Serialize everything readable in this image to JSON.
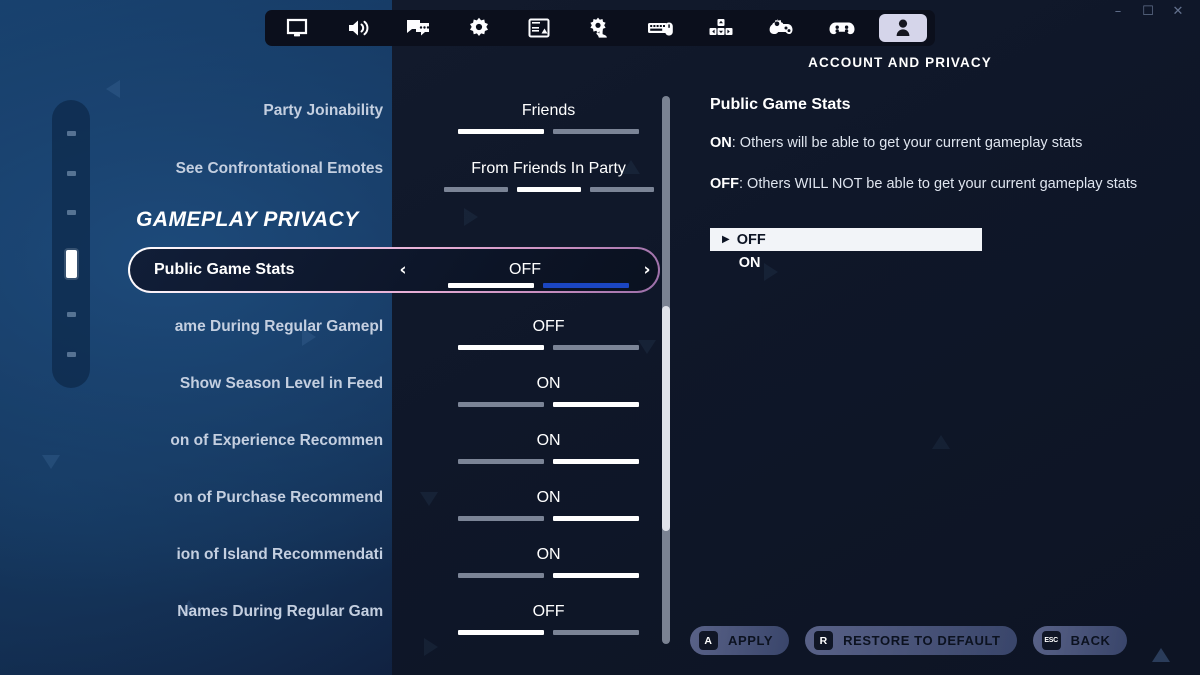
{
  "window": {
    "minimize": "–",
    "maximize": "☐",
    "close": "✕"
  },
  "tabs": [
    {
      "name": "video",
      "icon": "monitor-icon"
    },
    {
      "name": "audio",
      "icon": "speaker-icon"
    },
    {
      "name": "chat",
      "icon": "chat-bubbles-icon"
    },
    {
      "name": "game",
      "icon": "gear-icon"
    },
    {
      "name": "hud",
      "icon": "hud-layout-icon"
    },
    {
      "name": "brightness",
      "icon": "touch-gear-icon"
    },
    {
      "name": "keyboard",
      "icon": "keyboard-mouse-icon"
    },
    {
      "name": "wireless",
      "icon": "dpad-keys-icon"
    },
    {
      "name": "controller",
      "icon": "controller-gear-icon"
    },
    {
      "name": "gamepad",
      "icon": "gamepad-icon"
    },
    {
      "name": "account",
      "icon": "person-icon",
      "active": true
    }
  ],
  "header": {
    "title": "ACCOUNT AND PRIVACY"
  },
  "pager": {
    "total": 6,
    "active_index": 3
  },
  "section": {
    "title": "GAMEPLAY PRIVACY"
  },
  "settings": [
    {
      "label": "Party Joinability",
      "value": "Friends",
      "ticks": 2,
      "selected_tick": 0
    },
    {
      "label": "See Confrontational Emotes",
      "value": "From Friends In Party",
      "ticks": 3,
      "selected_tick": 1
    },
    {
      "label": "Public Game Stats",
      "value": "OFF",
      "ticks": 2,
      "selected_tick": 0,
      "highlighted": true,
      "left_arrow": "‹",
      "right_arrow": "›"
    },
    {
      "label": "ame During Regular Gamepl",
      "value": "OFF",
      "ticks": 2,
      "selected_tick": 0
    },
    {
      "label": "Show Season Level in Feed",
      "value": "ON",
      "ticks": 2,
      "selected_tick": 1
    },
    {
      "label": "on of Experience Recommen",
      "value": "ON",
      "ticks": 2,
      "selected_tick": 1
    },
    {
      "label": "on of Purchase Recommend",
      "value": "ON",
      "ticks": 2,
      "selected_tick": 1
    },
    {
      "label": "ion of Island Recommendati",
      "value": "ON",
      "ticks": 2,
      "selected_tick": 1
    },
    {
      "label": "Names During Regular Gam",
      "value": "OFF",
      "ticks": 2,
      "selected_tick": 0
    }
  ],
  "info": {
    "title": "Public Game Stats",
    "para_on_key": "ON",
    "para_on_text": ": Others will be able to get your current gameplay stats",
    "para_off_key": "OFF",
    "para_off_text": ": Others WILL NOT be able to get your current gameplay stats",
    "options": [
      {
        "label": "OFF",
        "selected": true,
        "caret": "▶"
      },
      {
        "label": "ON",
        "selected": false,
        "caret": "▶"
      }
    ]
  },
  "buttons": [
    {
      "key": "A",
      "label": "APPLY"
    },
    {
      "key": "R",
      "label": "RESTORE TO DEFAULT"
    },
    {
      "key": "ESC",
      "label": "BACK",
      "esc": true
    }
  ],
  "colors": {
    "accent_blue": "#1b46c2",
    "highlight_border": "#e7aed5",
    "panel_bg": "#0f1729",
    "active_tab_bg": "#d5d5ea"
  }
}
